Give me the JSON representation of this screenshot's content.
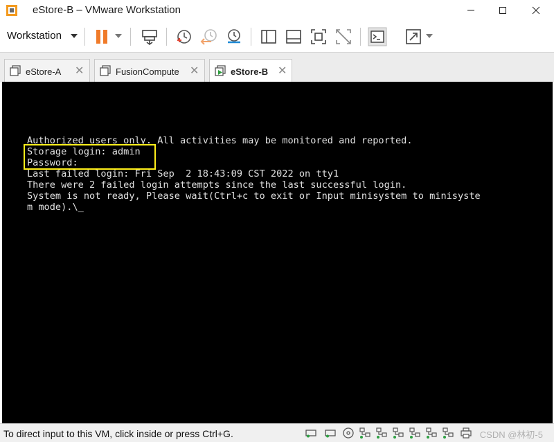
{
  "window": {
    "title": "eStore-B – VMware Workstation"
  },
  "toolbar": {
    "menu_label": "Workstation"
  },
  "tabs": [
    {
      "label": "eStore-A"
    },
    {
      "label": "FusionCompute"
    },
    {
      "label": "eStore-B"
    }
  ],
  "console": {
    "lines": [
      "Authorized users only. All activities may be monitored and reported.",
      "Storage login: admin",
      "Password:",
      "Last failed login: Fri Sep  2 18:43:09 CST 2022 on tty1",
      "There were 2 failed login attempts since the last successful login.",
      "System is not ready, Please wait(Ctrl+c to exit or Input minisystem to minisyste",
      "m mode).\\_"
    ]
  },
  "status": {
    "hint": "To direct input to this VM, click inside or press Ctrl+G.",
    "watermark": "CSDN @林初-5"
  },
  "colors": {
    "highlight_box": "#ffef1a",
    "console_bg": "#000000",
    "pause_orange": "#f07b2a"
  }
}
